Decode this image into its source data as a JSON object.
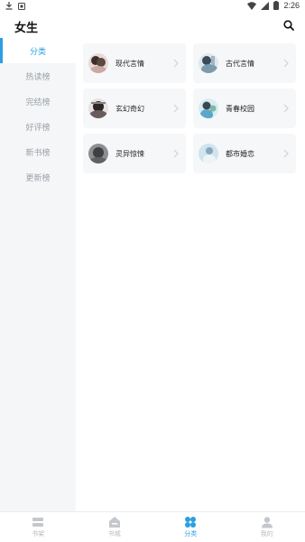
{
  "status_bar": {
    "time": "2:26"
  },
  "header": {
    "title": "女生"
  },
  "sidebar": {
    "items": [
      {
        "label": "分类",
        "active": true
      },
      {
        "label": "热读榜"
      },
      {
        "label": "完结榜"
      },
      {
        "label": "好评榜"
      },
      {
        "label": "新书榜"
      },
      {
        "label": "更新榜"
      }
    ]
  },
  "categories": [
    {
      "label": "现代言情"
    },
    {
      "label": "古代言情"
    },
    {
      "label": "玄幻奇幻"
    },
    {
      "label": "青春校园"
    },
    {
      "label": "灵异惊悚"
    },
    {
      "label": "都市婚恋"
    }
  ],
  "bottom_nav": [
    {
      "label": "书架",
      "icon": "bookshelf-icon"
    },
    {
      "label": "书城",
      "icon": "bookstore-icon"
    },
    {
      "label": "分类",
      "icon": "category-icon",
      "active": true
    },
    {
      "label": "我的",
      "icon": "profile-icon"
    }
  ],
  "colors": {
    "accent": "#2d9ee0",
    "sidebar_bg": "#f5f6f7",
    "card_bg": "#f6f7f8"
  }
}
